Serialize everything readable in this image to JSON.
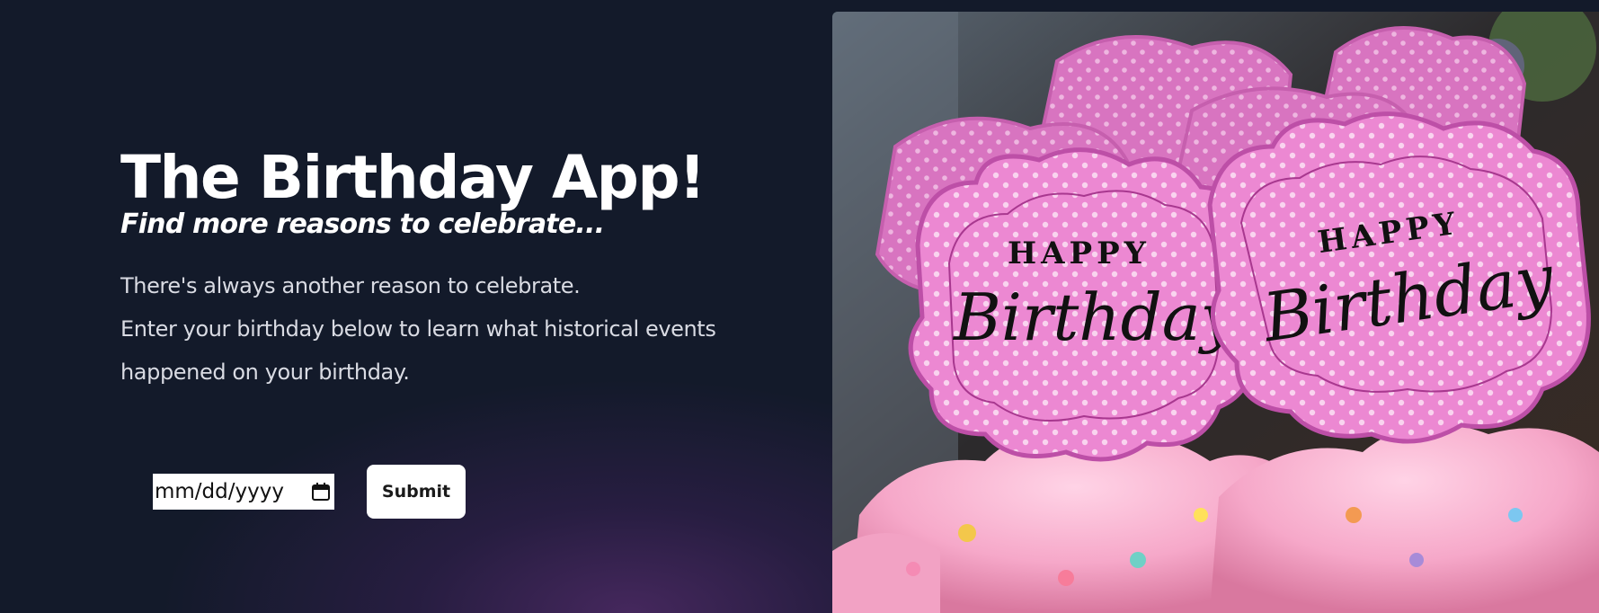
{
  "hero": {
    "title": "The Birthday App!",
    "subtitle": "Find more reasons to celebrate...",
    "description_line1": "There's always another reason to celebrate.",
    "description_line2": "Enter your birthday below to learn what historical events happened on your birthday."
  },
  "form": {
    "date_placeholder": "mm/dd/yyyy",
    "date_icon": "calendar-icon",
    "submit_label": "Submit"
  },
  "image": {
    "subject": "cupcakes-with-happy-birthday-toppers",
    "topper_text_small": "HAPPY",
    "topper_text_large": "Birthday"
  },
  "colors": {
    "background": "#131a2a",
    "accent_glow": "#4e2a66",
    "text_primary": "#ffffff",
    "text_secondary": "#d9dbe3",
    "topper_pink": "#f08fd6"
  }
}
